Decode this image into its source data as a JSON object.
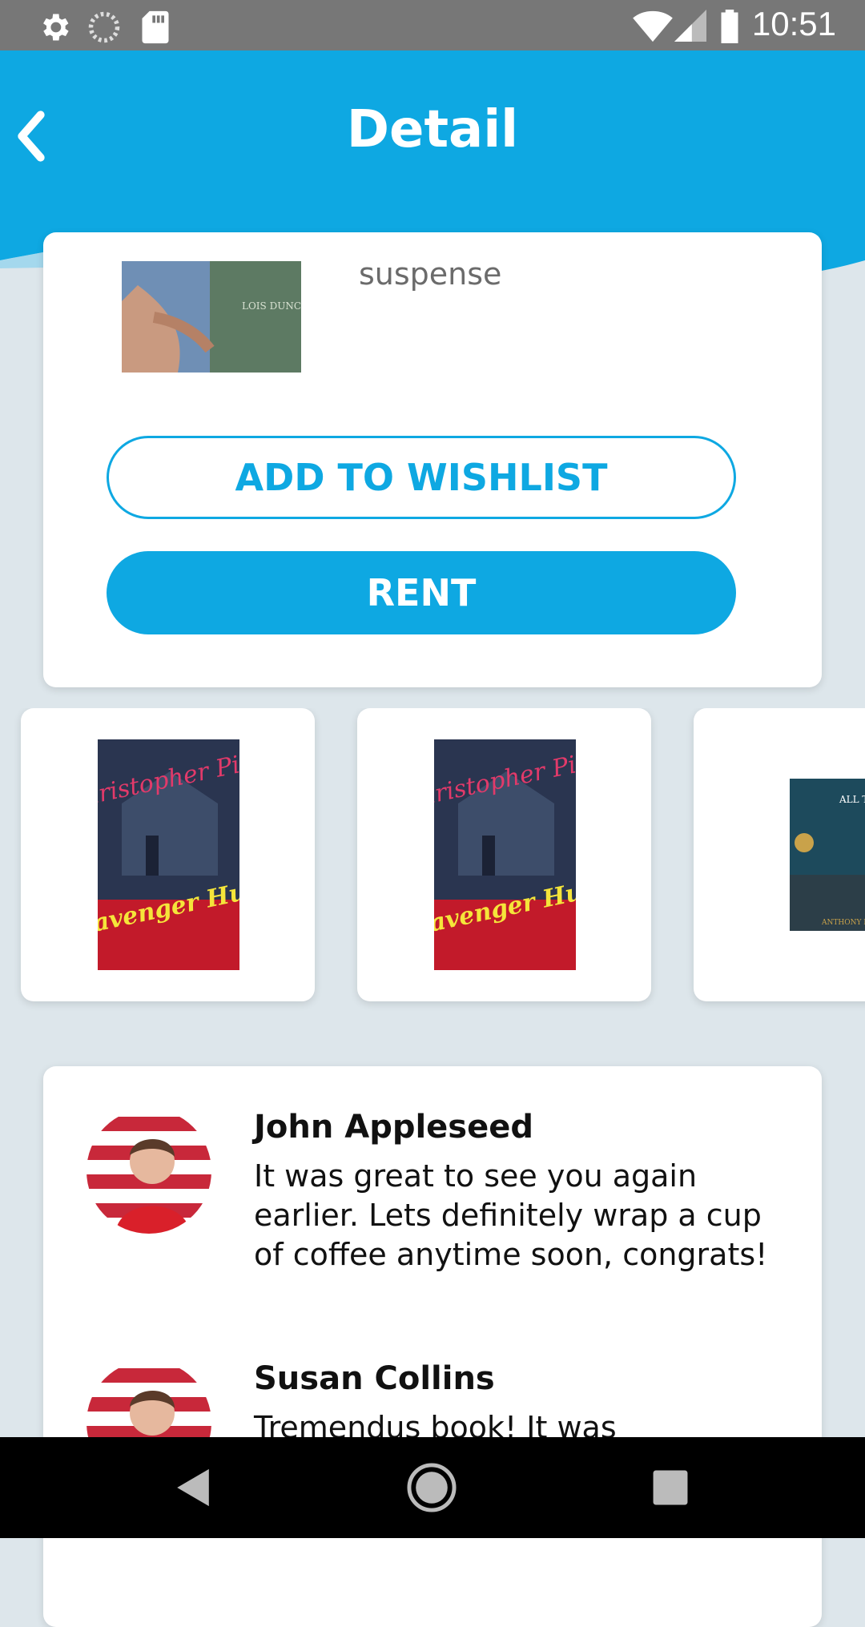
{
  "status_bar": {
    "time": "10:51",
    "left_icons": [
      "settings-icon",
      "sync-icon",
      "sd-card-icon"
    ],
    "right_icons": [
      "wifi-icon",
      "signal-icon",
      "battery-icon"
    ]
  },
  "header": {
    "title": "Detail",
    "back_icon": "chevron-left-icon",
    "color": "#0ea8e2"
  },
  "book": {
    "genre": "suspense",
    "cover_author_text": "LOIS DUNCAN"
  },
  "actions": {
    "wishlist_label": "ADD TO WISHLIST",
    "rent_label": "RENT",
    "accent": "#0ea8e2"
  },
  "related_books": [
    {
      "cover": "scavenger-hunt-cover",
      "title_text": "Scavenger Hunt",
      "author_text": "Christopher Pike"
    },
    {
      "cover": "scavenger-hunt-cover",
      "title_text": "Scavenger Hunt",
      "author_text": "Christopher Pike"
    },
    {
      "cover": "all-the-light-cover",
      "title_text": "ALL THE LIGHT WE CANNOT SEE",
      "author_text": "ANTHONY DO"
    }
  ],
  "reviews": [
    {
      "name": "John Appleseed",
      "text": "It was great to see you again earlier. Lets definitely wrap a cup of coffee anytime soon, congrats!"
    },
    {
      "name": "Susan Collins",
      "text": "Tremendus book! It was"
    }
  ],
  "nav_bar": [
    "back-triangle-icon",
    "home-circle-icon",
    "recents-square-icon"
  ]
}
